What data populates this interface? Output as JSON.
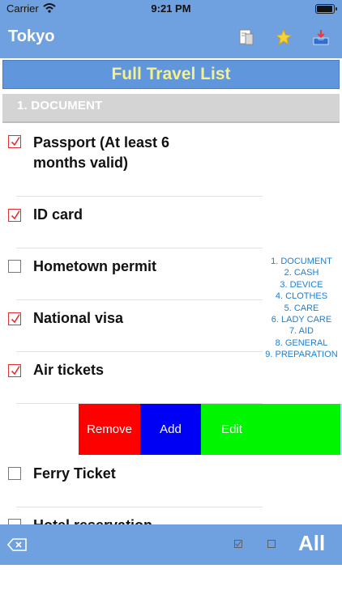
{
  "status_bar": {
    "carrier": "Carrier",
    "time": "9:21 PM"
  },
  "nav": {
    "title": "Tokyo",
    "icons": [
      "document-icon",
      "star-icon",
      "inbox-download-icon"
    ]
  },
  "banner": {
    "title": "Full Travel List"
  },
  "section": {
    "title": "1. DOCUMENT"
  },
  "items": [
    {
      "label": "Passport (At least 6 months valid)",
      "checked": true
    },
    {
      "label": "ID card",
      "checked": true
    },
    {
      "label": "Hometown permit",
      "checked": false
    },
    {
      "label": "National visa",
      "checked": true
    },
    {
      "label": "Air tickets",
      "checked": true
    },
    {
      "label": "Ferry Ticket",
      "checked": false
    },
    {
      "label": "Hotel reservation",
      "checked": false
    }
  ],
  "swipe_actions": {
    "remove": "Remove",
    "add": "Add",
    "edit": "Edit"
  },
  "index": [
    "1. DOCUMENT",
    "2. CASH",
    "3. DEVICE",
    "4. CLOTHES",
    "5. CARE",
    "6. LADY CARE",
    "7. AID",
    "8. GENERAL",
    "9. PREPARATION"
  ],
  "toolbar": {
    "all_label": "All"
  },
  "colors": {
    "bar": "#6fa0e0",
    "banner": "#5f96dc",
    "banner_text": "#f6f08c",
    "check": "#e03030",
    "index_text": "#1a7fd6",
    "remove": "#fd0000",
    "add": "#0000f5",
    "edit": "#00f500"
  }
}
